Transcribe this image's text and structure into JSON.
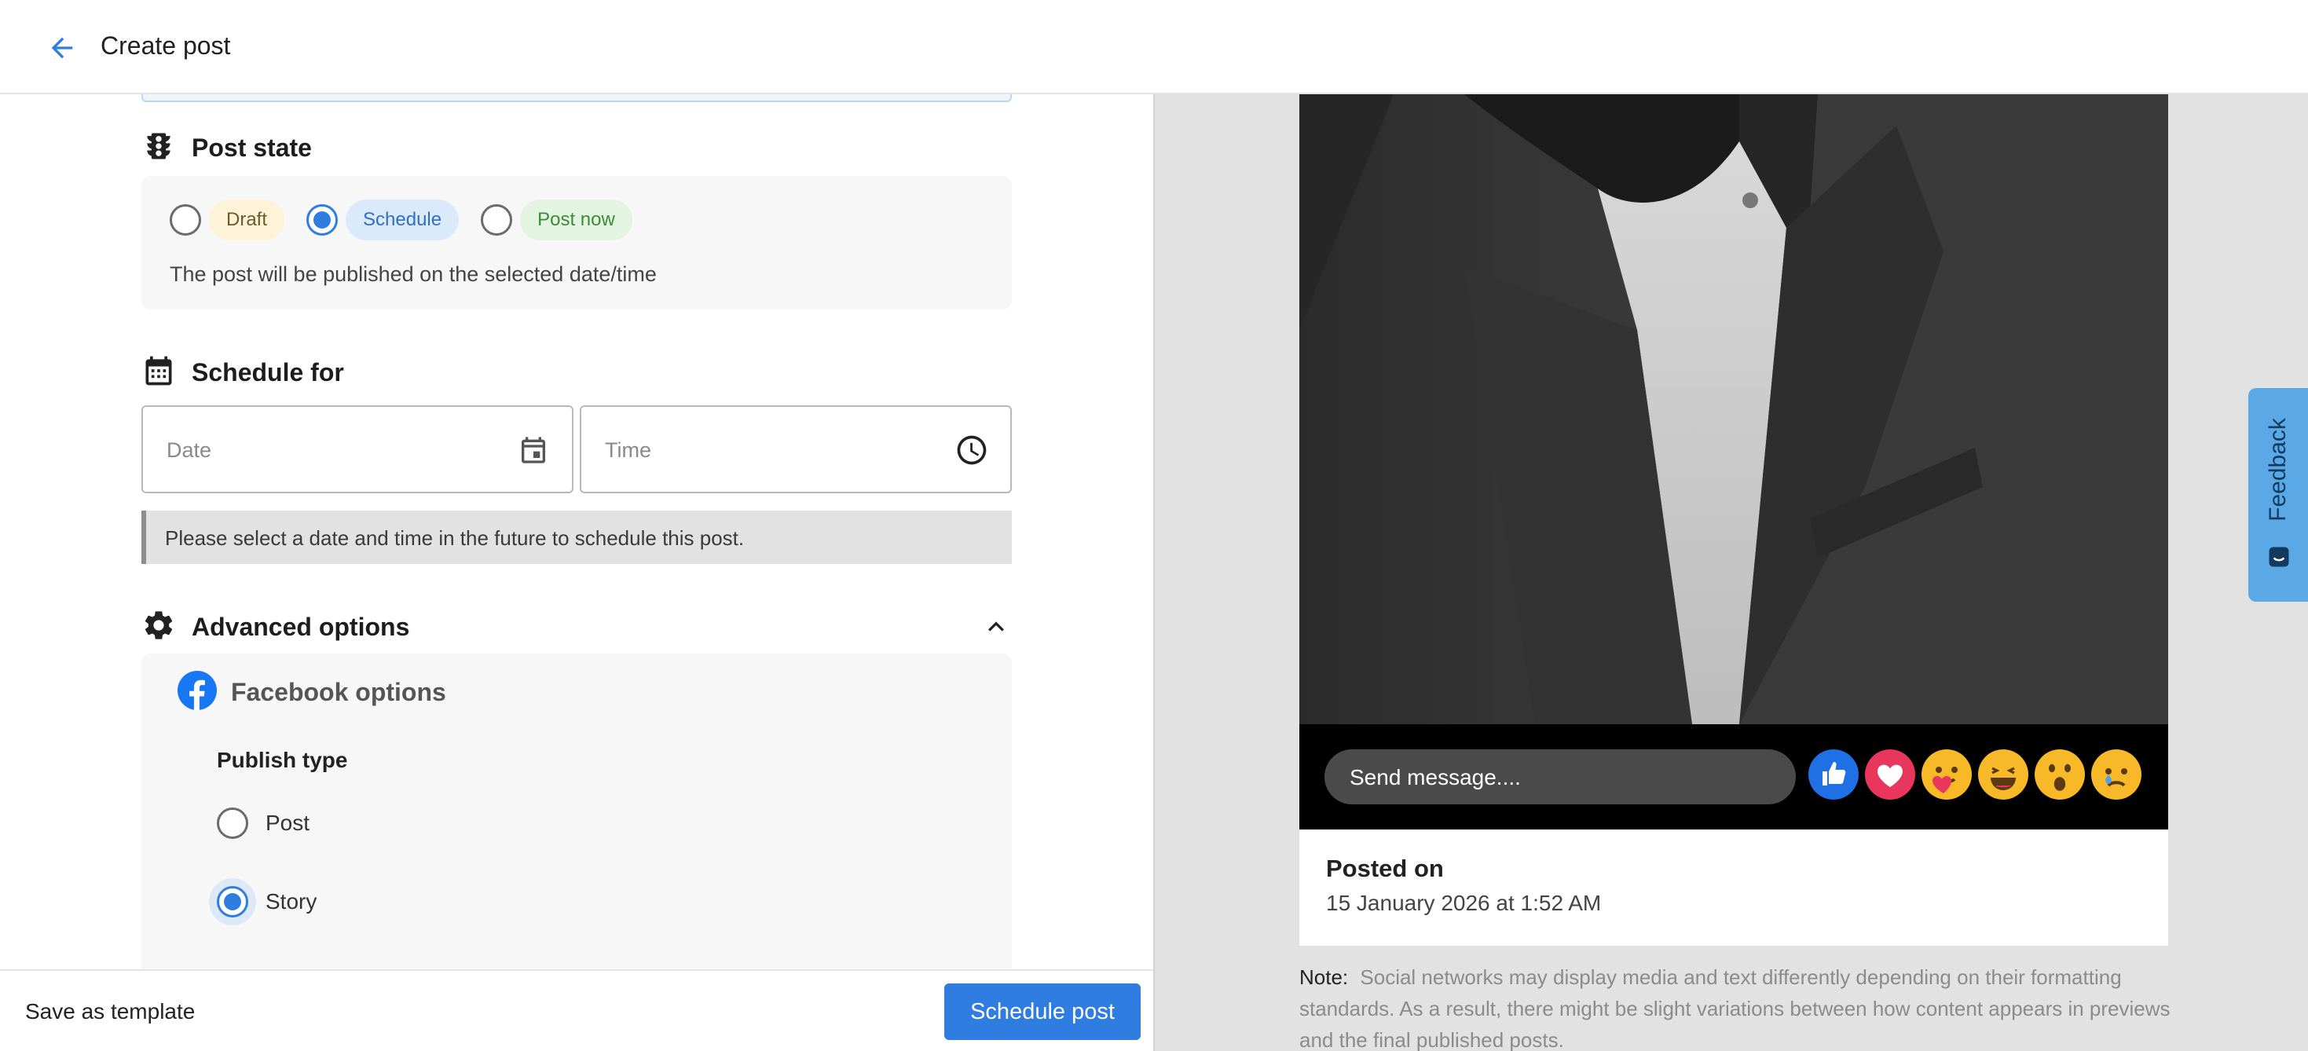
{
  "header": {
    "title": "Create post"
  },
  "post_state": {
    "heading": "Post state",
    "options": [
      {
        "label": "Draft",
        "selected": false
      },
      {
        "label": "Schedule",
        "selected": true
      },
      {
        "label": "Post now",
        "selected": false
      }
    ],
    "description": "The post will be published on the selected date/time"
  },
  "schedule": {
    "heading": "Schedule for",
    "date_placeholder": "Date",
    "time_placeholder": "Time",
    "hint": "Please select a date and time in the future to schedule this post."
  },
  "advanced": {
    "heading": "Advanced options",
    "facebook_heading": "Facebook options",
    "publish_type_label": "Publish type",
    "publish_types": [
      {
        "label": "Post",
        "selected": false
      },
      {
        "label": "Story",
        "selected": true
      }
    ]
  },
  "footer": {
    "save_template": "Save as template",
    "schedule_button": "Schedule post"
  },
  "preview": {
    "message_placeholder": "Send message....",
    "reactions": [
      "like-icon",
      "love-icon",
      "care-icon",
      "haha-icon",
      "wow-icon",
      "sad-icon"
    ],
    "posted_label": "Posted on",
    "posted_date": "15 January 2026 at 1:52 AM",
    "note_label": "Note:",
    "note_text": "Social networks may display media and text differently depending on their formatting standards. As a result, there might be slight variations between how content appears in previews and the final published posts."
  },
  "feedback_tab": {
    "label": "Feedback"
  },
  "colors": {
    "accent": "#2f7de1",
    "facebook": "#1877f2",
    "feedback_tab": "#5aa9e6"
  }
}
